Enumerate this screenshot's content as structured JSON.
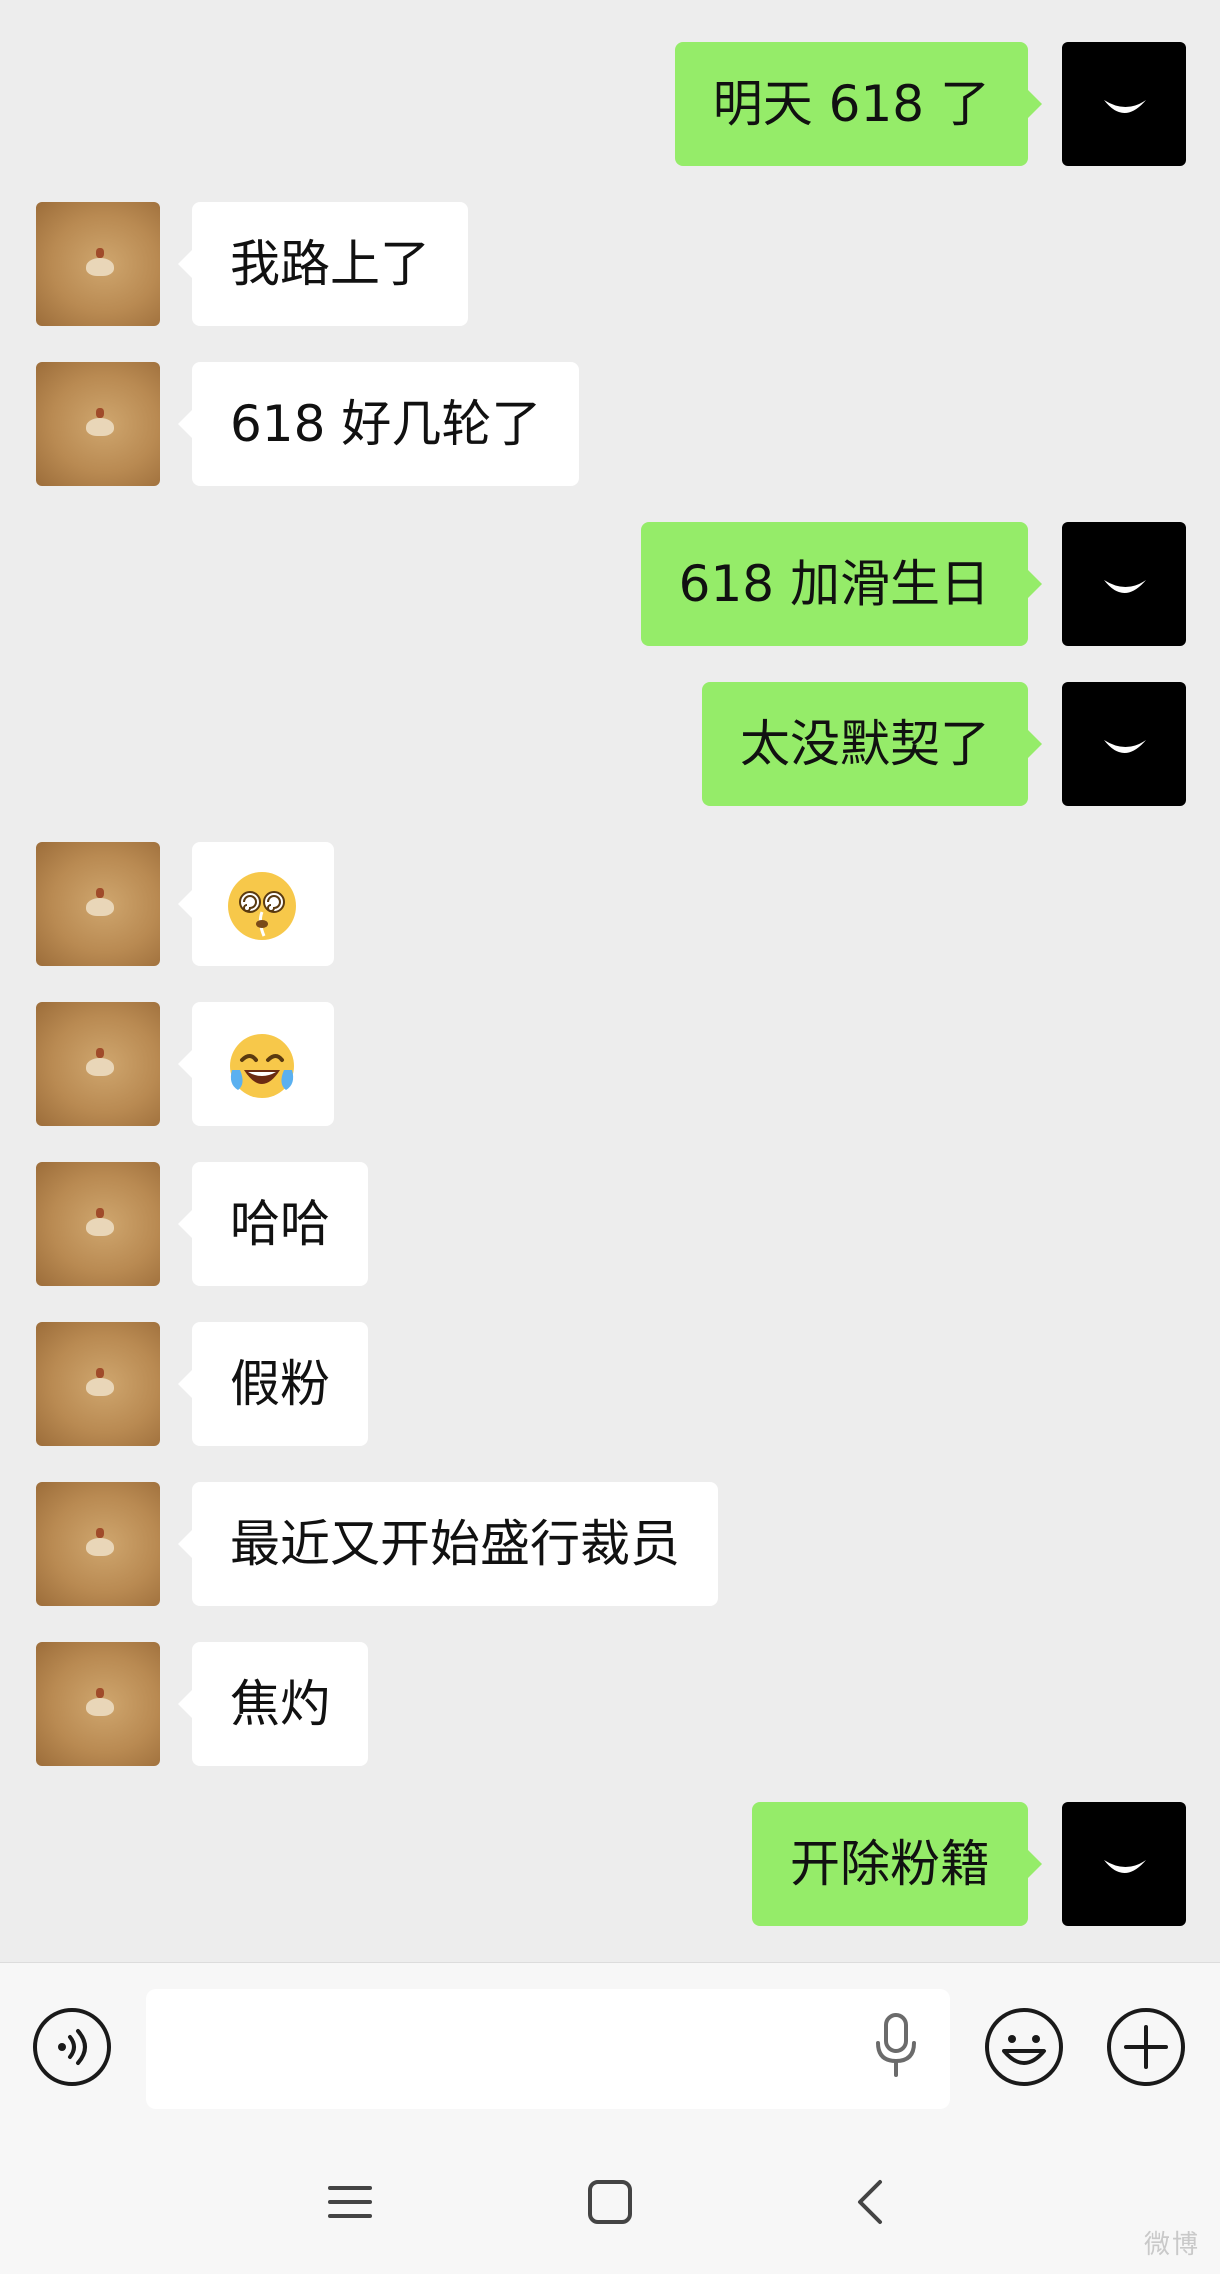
{
  "messages": [
    {
      "side": "right",
      "text": "明天 618 了"
    },
    {
      "side": "left",
      "text": "我路上了"
    },
    {
      "side": "left",
      "text": "618 好几轮了"
    },
    {
      "side": "right",
      "text": "618 加滑生日"
    },
    {
      "side": "right",
      "text": "太没默契了"
    },
    {
      "side": "left",
      "emoji": "spiral-eyes-emoji"
    },
    {
      "side": "left",
      "emoji": "tears-of-joy-emoji"
    },
    {
      "side": "left",
      "text": "哈哈"
    },
    {
      "side": "left",
      "text": "假粉"
    },
    {
      "side": "left",
      "text": "最近又开始盛行裁员"
    },
    {
      "side": "left",
      "text": "焦灼"
    },
    {
      "side": "right",
      "text": "开除粉籍"
    }
  ],
  "input": {
    "value": ""
  },
  "icons": {
    "voice": "voice-toggle-icon",
    "mic": "microphone-icon",
    "emoji": "emoji-icon",
    "plus": "plus-icon",
    "nav_menu": "menu-icon",
    "nav_home": "home-icon",
    "nav_back": "back-icon"
  },
  "colors": {
    "chat_background": "#ededed",
    "self_bubble": "#95ec69",
    "other_bubble": "#ffffff"
  },
  "watermark": "微博"
}
